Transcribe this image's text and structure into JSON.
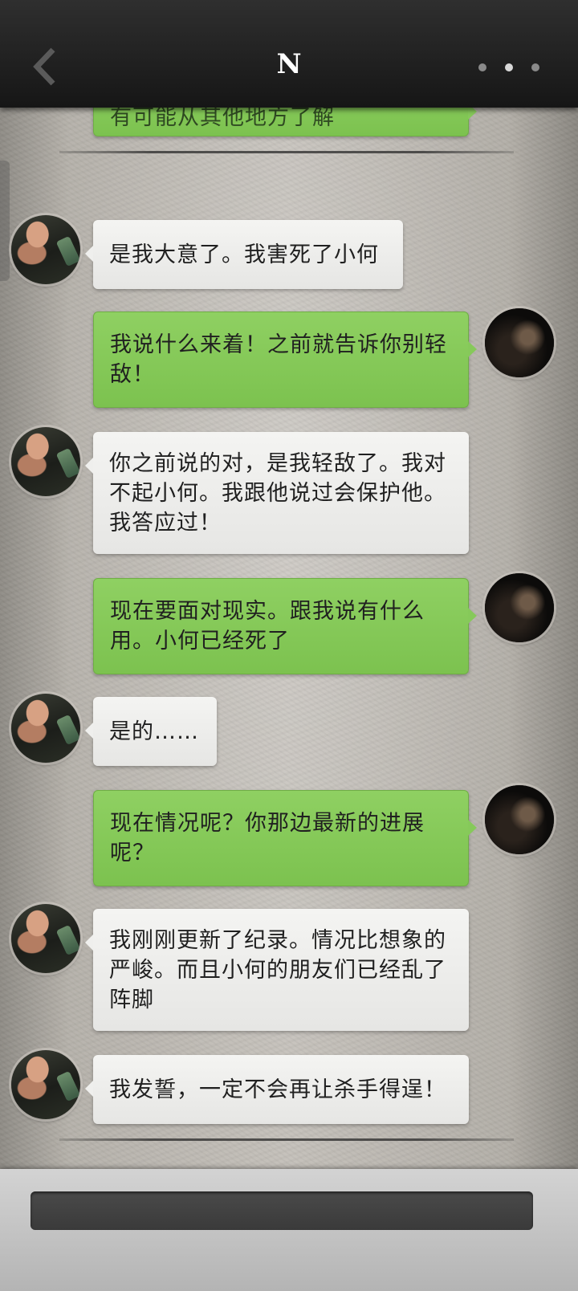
{
  "header": {
    "title": "N",
    "back_icon": "chevron-left-icon",
    "more_icon": "more-dots-icon"
  },
  "messages": [
    {
      "side": "out",
      "text": "有可能从其他地方了解",
      "partial": true
    },
    {
      "side": "in",
      "text": "是我大意了。我害死了小何"
    },
    {
      "side": "out",
      "lines": [
        "我说什么来着！之前就告诉你别轻",
        "敌！"
      ]
    },
    {
      "side": "in",
      "lines": [
        "你之前说的对，是我轻敌了。我对",
        "不起小何。我跟他说过会保护他。",
        "我答应过！"
      ]
    },
    {
      "side": "out",
      "lines": [
        "现在要面对现实。跟我说有什么",
        "用。小何已经死了"
      ]
    },
    {
      "side": "in",
      "text": "是的……"
    },
    {
      "side": "out",
      "lines": [
        "现在情况呢？你那边最新的进展",
        "呢？"
      ]
    },
    {
      "side": "in",
      "lines": [
        "我刚刚更新了纪录。情况比想象的",
        "严峻。而且小何的朋友们已经乱了",
        "阵脚"
      ]
    },
    {
      "side": "in",
      "text": "我发誓，一定不会再让杀手得逞！"
    }
  ],
  "colors": {
    "header_bg": "#1e1e1e",
    "outgoing_bubble": "#86c95a",
    "incoming_bubble": "#efefed",
    "input_bar": "#c4c4c4",
    "input_field": "#404040"
  }
}
